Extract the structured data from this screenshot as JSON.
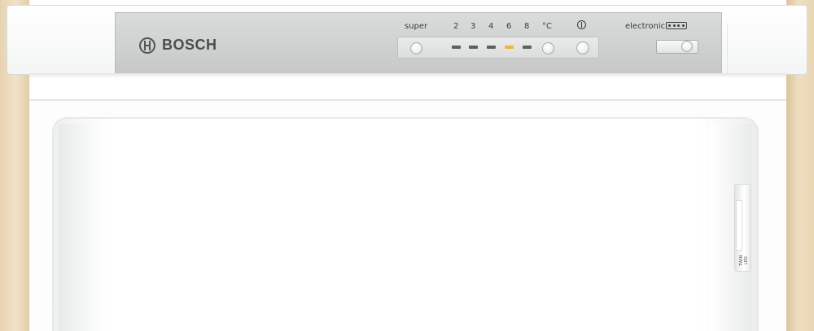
{
  "brand": {
    "name": "BOSCH"
  },
  "control_panel": {
    "super_label": "super",
    "temperature_steps": [
      "2",
      "3",
      "4",
      "6",
      "8"
    ],
    "unit_label": "°C",
    "active_step": "6",
    "power_icon": "power-knob-icon",
    "mode_label": "electronic",
    "mode_icon": "star-dots-icon"
  },
  "door": {
    "badge_text": "TWIN LED"
  },
  "colors": {
    "body_side": "#e9d6b4",
    "panel": "#d2d4d4",
    "active_led": "#f1b539",
    "inactive_led": "#5d5f60"
  }
}
